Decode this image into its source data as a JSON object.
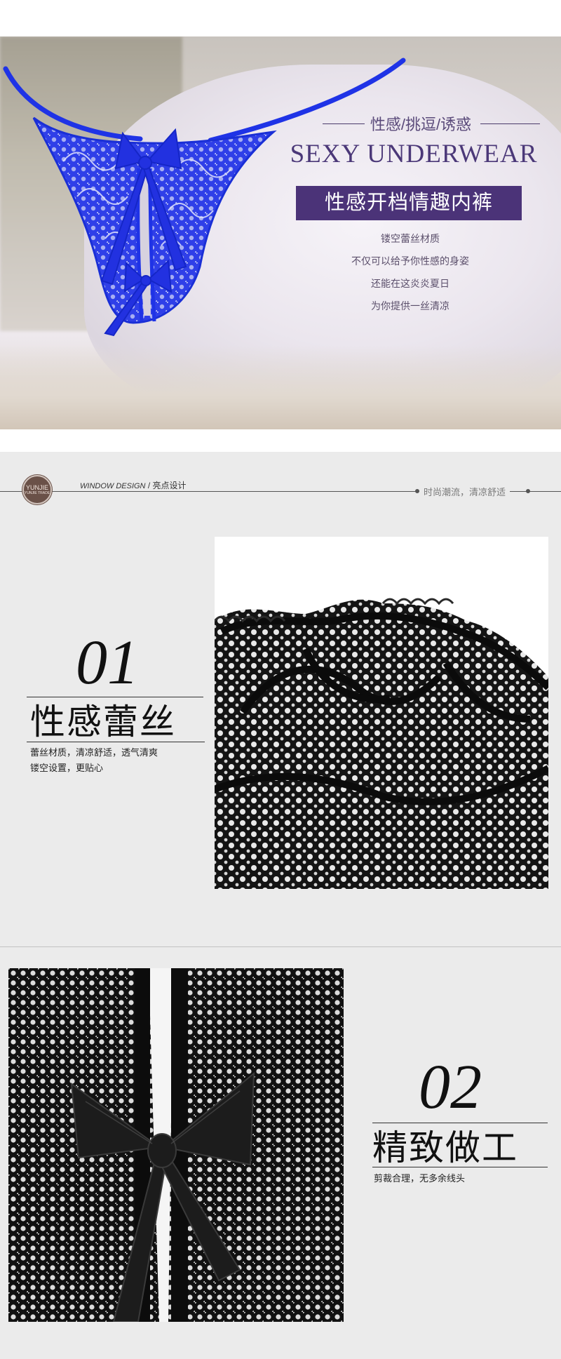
{
  "hero": {
    "kicker": "性感/挑逗/诱惑",
    "title": "SEXY UNDERWEAR",
    "badge": "性感开档情趣内裤",
    "desc": [
      "镂空蕾丝材质",
      "不仅可以给予你性感的身姿",
      "还能在这炎炎夏日",
      "为你提供一丝清凉"
    ],
    "accent_color": "#4b3378",
    "product_color": "#2535e6"
  },
  "section_header": {
    "logo_text": "YUNJIE",
    "logo_sub": "YUNJIE TRADE",
    "label_en": "WINDOW DESIGN",
    "label_cn": "/ 亮点设计",
    "right_text": "时尚潮流，清凉舒适"
  },
  "feature1": {
    "number": "01",
    "title": "性感蕾丝",
    "desc": [
      "蕾丝材质，清凉舒适，透气清爽",
      "镂空设置，更贴心"
    ]
  },
  "feature2": {
    "number": "02",
    "title": "精致做工",
    "desc": [
      "剪裁合理，无多余线头"
    ]
  }
}
